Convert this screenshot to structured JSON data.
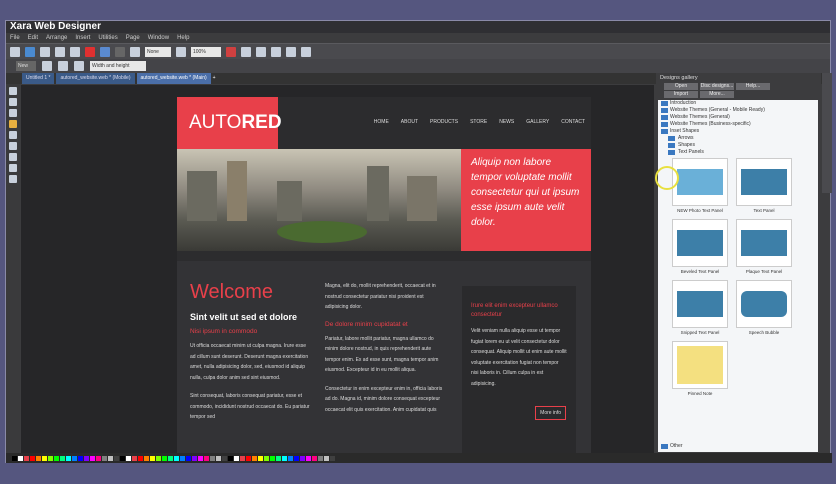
{
  "window": {
    "title": "Xara Web Designer"
  },
  "menu": [
    "File",
    "Edit",
    "Arrange",
    "Insert",
    "Utilities",
    "Page",
    "Window",
    "Help"
  ],
  "toolbar": {
    "quality": "None",
    "zoom": "100%"
  },
  "toolbar2": {
    "new_label": "New",
    "size_mode": "Width and height"
  },
  "tabs": [
    "Untitled 1 *",
    "autored_website.web * (Mobile)",
    "autored_website.web * (Main)"
  ],
  "site": {
    "logo_a": "AUTO",
    "logo_b": "RED",
    "nav": [
      "HOME",
      "ABOUT",
      "PRODUCTS",
      "STORE",
      "NEWS",
      "GALLERY",
      "CONTACT"
    ],
    "hero_text": "Aliquip non labore tempor voluptate mollit consectetur qui ut ipsum esse ipsum aute velit dolor.",
    "welcome": "Welcome",
    "subtitle": "Sint velit ut sed et dolore",
    "red1": "Nisi ipsum in commodo",
    "p1": "Ut officia occaecat minim ut culpa magna. Irure esse ad cillum sunt deserunt. Deserunt magna exercitation amet, nulla adipisicing dolor, sed, eiusmod id aliquip nulla, culpa dolor anim sed sint eiusmod.",
    "p2": "Sint consequat, laboris consequat pariatur, esse et commodo, incididunt nostrud occaecat do. Eu pariatur tempor sed",
    "p3": "Magna, elit do, mollit reprehenderit, occaecat et in nostrud consectetur pariatur nisi proident est adipisicing dolor.",
    "red2": "De dolore minim cupidatat et",
    "p4": "Pariatur, labore mollit pariatur, magna ullamco do minim dolore nostrud, in quis reprehenderit aute tempor enim. Ex ad esse sunt, magna tempor anim eiusmod. Excepteur id in eu mollit aliqua.",
    "p5": "Consectetur in enim excepteur enim in, officia laboris ad do. Magna id, minim dolore consequat excepteur occaecat elit quis exercitation. Anim cupidatat quis",
    "side_title": "Irure elit enim excepteur ullamco consectetur",
    "side_text": "Velit veniam nulla aliquip esse ut tempor fugiat lorem eu ut velit consectetur dolor consequat. Aliquip mollit ut enim aute mollit voluptate exercitation fugiat non tempor nisi laboris in. Cillum culpa in est adipisicing.",
    "more": "More info"
  },
  "gallery": {
    "title": "Designs gallery",
    "buttons": [
      "Open",
      "Disc designs...",
      "Help...",
      "Import",
      "More..."
    ],
    "folders": [
      "Introduction",
      "Website Themes (General - Mobile Ready)",
      "Website Themes (General)",
      "Website Themes (Business-specific)",
      "Inset Shapes"
    ],
    "subfolders": [
      "Arrows",
      "Shapes",
      "Text Panels"
    ],
    "items": [
      "NEW Photo Text Panel",
      "Text Panel",
      "Beveled Text Panel",
      "Plaque Text Panel",
      "Snipped Text Panel",
      "Speech Bubble",
      "Pinned Note"
    ],
    "other": "Other"
  },
  "palette": [
    "#000000",
    "#ffffff",
    "#e8404a",
    "#ff0000",
    "#ff8000",
    "#ffff00",
    "#80ff00",
    "#00ff00",
    "#00ff80",
    "#00ffff",
    "#0080ff",
    "#0000ff",
    "#8000ff",
    "#ff00ff",
    "#ff0080",
    "#808080",
    "#c0c0c0",
    "#404040"
  ]
}
